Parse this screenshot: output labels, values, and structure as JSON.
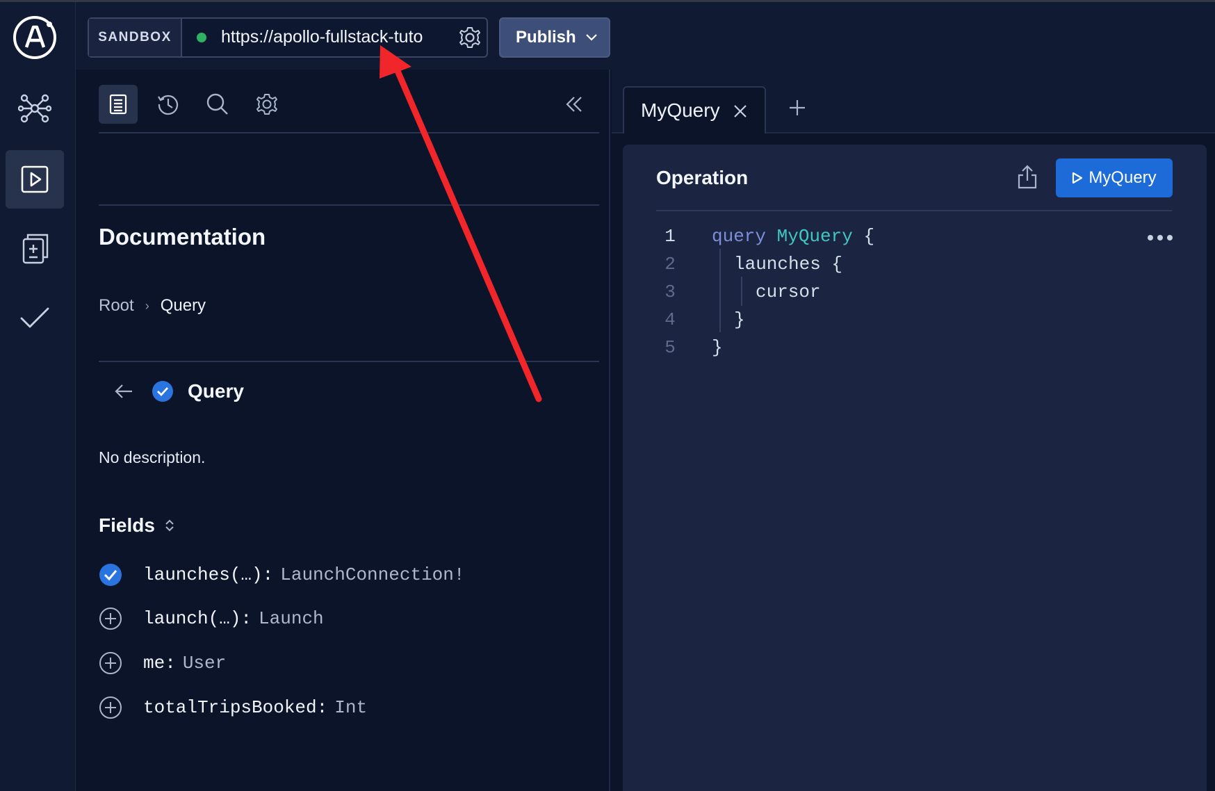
{
  "header": {
    "sandbox_label": "SANDBOX",
    "endpoint_url": "https://apollo-fullstack-tutorial",
    "endpoint_status_color": "#2fb162",
    "publish_label": "Publish"
  },
  "sidebar": {
    "items": [
      {
        "icon": "schema-graph-icon",
        "active": false
      },
      {
        "icon": "explorer-play-icon",
        "active": true
      },
      {
        "icon": "changelog-diff-icon",
        "active": false
      },
      {
        "icon": "checks-icon",
        "active": false
      }
    ]
  },
  "docs": {
    "tools": [
      "documentation-icon",
      "history-icon",
      "search-icon",
      "settings-icon"
    ],
    "title": "Documentation",
    "breadcrumb": {
      "root": "Root",
      "separator": "›",
      "current": "Query"
    },
    "type_name": "Query",
    "description": "No description.",
    "fields_title": "Fields",
    "fields": [
      {
        "name": "launches(…):",
        "type": "LaunchConnection!",
        "selected": true
      },
      {
        "name": "launch(…):",
        "type": "Launch",
        "selected": false
      },
      {
        "name": "me:",
        "type": "User",
        "selected": false
      },
      {
        "name": "totalTripsBooked:",
        "type": "Int",
        "selected": false
      }
    ]
  },
  "tabs": [
    {
      "label": "MyQuery"
    }
  ],
  "editor": {
    "title": "Operation",
    "run_label": "MyQuery",
    "accent_color": "#1d6bd9",
    "lines": [
      {
        "num": "1",
        "kw": "query",
        "name": "MyQuery",
        "rest": " {"
      },
      {
        "num": "2",
        "text": "launches {"
      },
      {
        "num": "3",
        "text": "cursor"
      },
      {
        "num": "4",
        "text": "}"
      },
      {
        "num": "5",
        "text": "}"
      }
    ]
  },
  "annotation": {
    "arrow_color": "#f0262a"
  }
}
